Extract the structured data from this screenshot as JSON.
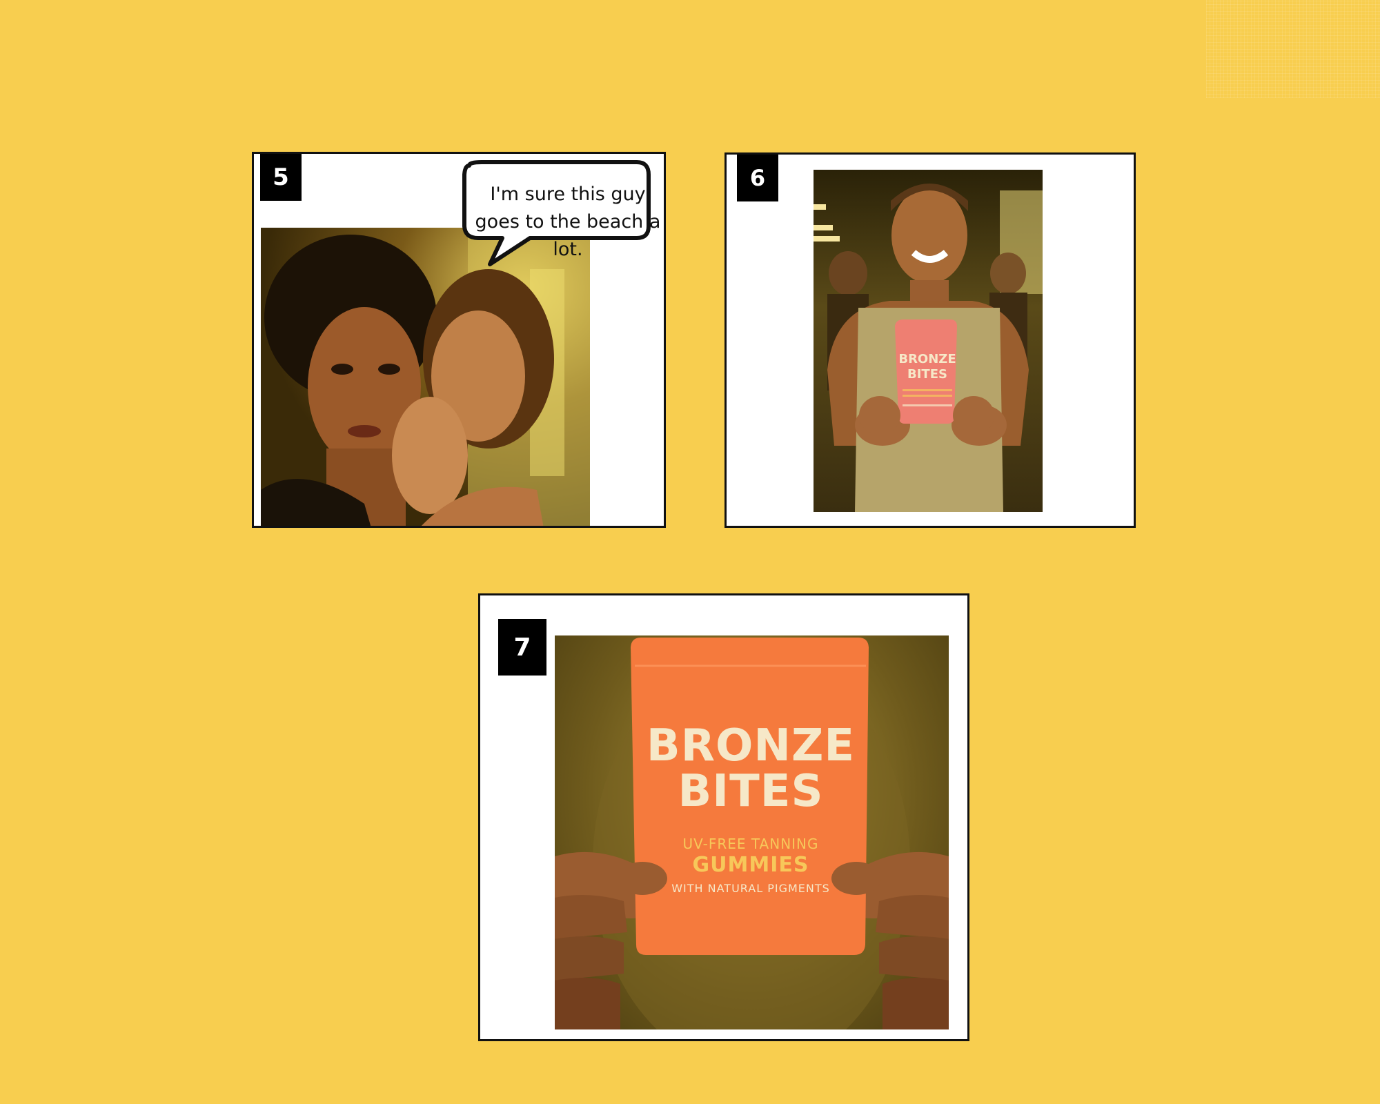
{
  "panels": [
    {
      "number": "5",
      "bubble_text": "I'm sure this guy goes to the beach a lot."
    },
    {
      "number": "6",
      "pouch": {
        "brand_line1": "BRONZE",
        "brand_line2": "BITES"
      }
    },
    {
      "number": "7",
      "pouch": {
        "brand_line1": "BRONZE",
        "brand_line2": "BITES",
        "line1": "UV-FREE TANNING",
        "line2": "GUMMIES",
        "line3": "WITH NATURAL PIGMENTS"
      }
    }
  ],
  "colors": {
    "background": "#f8ce4f",
    "panel_border": "#111111",
    "pouch_orange": "#f57a3d",
    "pouch_pink": "#ee7f72",
    "pouch_text_cream": "#f6e8c8",
    "pouch_text_yellow": "#f7c85a"
  },
  "icons": [
    "speech-bubble-icon"
  ]
}
